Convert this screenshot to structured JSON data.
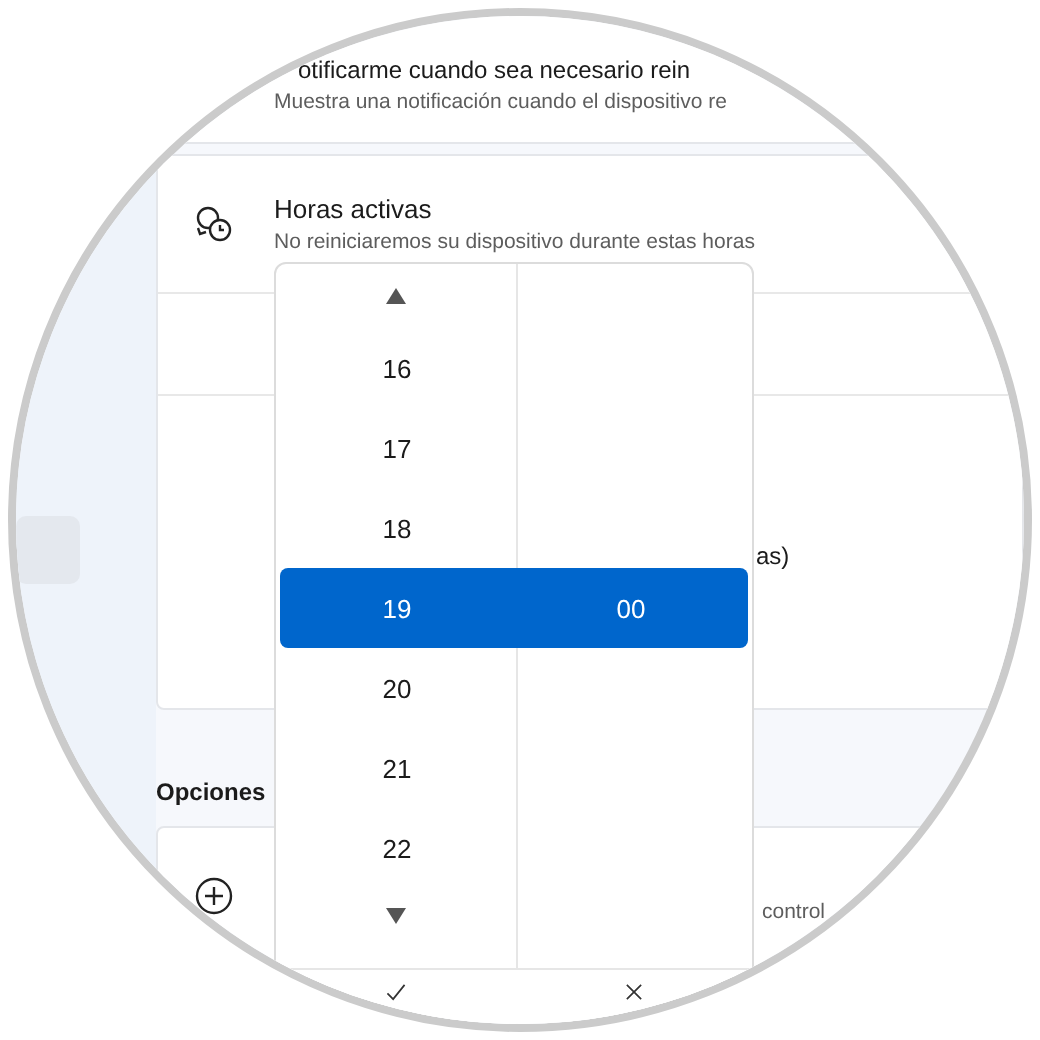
{
  "notify_row": {
    "title": "otificarme cuando sea necesario rein",
    "description": "Muestra una notificación cuando el dispositivo re"
  },
  "active_hours": {
    "title": "Horas activas",
    "description": "No reiniciaremos su dispositivo durante estas horas",
    "field_text": "as)"
  },
  "section_heading": "Opciones",
  "options_row": {
    "description": "control"
  },
  "time_picker": {
    "rows": [
      {
        "hour": "16",
        "selected": false
      },
      {
        "hour": "17",
        "selected": false
      },
      {
        "hour": "18",
        "selected": false
      },
      {
        "hour": "19",
        "minute": "00",
        "selected": true
      },
      {
        "hour": "20",
        "selected": false
      },
      {
        "hour": "21",
        "selected": false
      },
      {
        "hour": "22",
        "selected": false
      }
    ]
  }
}
